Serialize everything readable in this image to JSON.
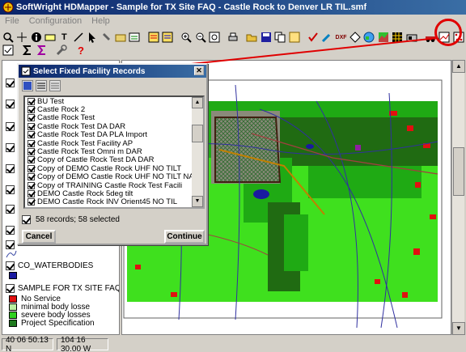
{
  "window": {
    "title": "SoftWright HDMapper - Sample for TX Site FAQ - Castle Rock to Denver LR TIL.smf"
  },
  "menu": [
    "File",
    "Configuration",
    "Help"
  ],
  "dialog": {
    "title": "Select Fixed Facility Records",
    "records": [
      "BU Test",
      "Castle Rock 2",
      "Castle Rock Test",
      "Castle Rock Test DA   DAR",
      "Castle Rock Test DA   PLA Import",
      "Castle Rock Test Facility AP",
      "Castle Rock Test Omni m DAR",
      "Copy of Castle Rock Test DA   DAR",
      "Copy of DEMO Castle Rock UHF NO TILT",
      "Copy of DEMO Castle Rock UHF NO TILT NAD",
      "Copy of TRAINING Castle Rock Test Facili",
      "DEMO Castle Rock 5deg tilt",
      "DEMO Castle Rock INV Orient45 NO TIL"
    ],
    "count_text": "58 records; 58 selected",
    "cancel_label": "Cancel",
    "continue_label": "Continue"
  },
  "legend": {
    "waterbodies": "CO_WATERBODIES",
    "coverage_title": "SAMPLE FOR TX SITE FAQ - CAS",
    "items": [
      {
        "label": "No Service",
        "color": "#e01010"
      },
      {
        "label": "minimal body losse",
        "color": "#b8f0a0"
      },
      {
        "label": "severe body losses",
        "color": "#30d020"
      },
      {
        "label": "Project Specification",
        "color": "#1e7a1e"
      }
    ]
  },
  "status": {
    "lat": "40 06 50.13 N",
    "lon": "104 16 30.00 W"
  },
  "colors": {
    "light_green": "#3fe01e",
    "mid_green": "#1faa14",
    "dark_green": "#206b12",
    "red": "#e01010",
    "blue": "#1a1aa0"
  },
  "icons": [
    "zoom-icon",
    "info-icon",
    "text-icon",
    "print-icon",
    "save-icon",
    "select-records-icon",
    "help-icon",
    "sum-icon"
  ]
}
